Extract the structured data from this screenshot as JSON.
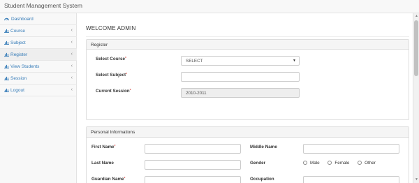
{
  "app": {
    "title": "Student Management System"
  },
  "sidebar": {
    "items": [
      {
        "label": "Dashboard",
        "icon": "dashboard-icon",
        "has_submenu": false
      },
      {
        "label": "Course",
        "icon": "bar-chart-icon",
        "has_submenu": true
      },
      {
        "label": "Subject",
        "icon": "bar-chart-icon",
        "has_submenu": true
      },
      {
        "label": "Register",
        "icon": "bar-chart-icon",
        "has_submenu": true,
        "active": true
      },
      {
        "label": "View Students",
        "icon": "bar-chart-icon",
        "has_submenu": true
      },
      {
        "label": "Session",
        "icon": "bar-chart-icon",
        "has_submenu": true
      },
      {
        "label": "Logout",
        "icon": "bar-chart-icon",
        "has_submenu": true
      }
    ],
    "chevron": "‹"
  },
  "main": {
    "title": "WELCOME ADMIN",
    "register_panel": {
      "heading": "Register",
      "course_label": "Select Course",
      "course_value": "SELECT",
      "subject_label": "Select Subject",
      "subject_value": "",
      "session_label": "Current Session",
      "session_value": "2010-2011"
    },
    "personal_panel": {
      "heading": "Personal Informations",
      "first_name_label": "First Name",
      "middle_name_label": "Middle Name",
      "last_name_label": "Last Name",
      "gender_label": "Gender",
      "gender_options": [
        "Male",
        "Female",
        "Other"
      ],
      "guardian_name_label": "Guardian Name",
      "occupation_label": "Occupation"
    },
    "required_mark": "*"
  },
  "colors": {
    "link": "#337ab7",
    "required": "#d9534f",
    "panel_head": "#f5f5f5"
  }
}
